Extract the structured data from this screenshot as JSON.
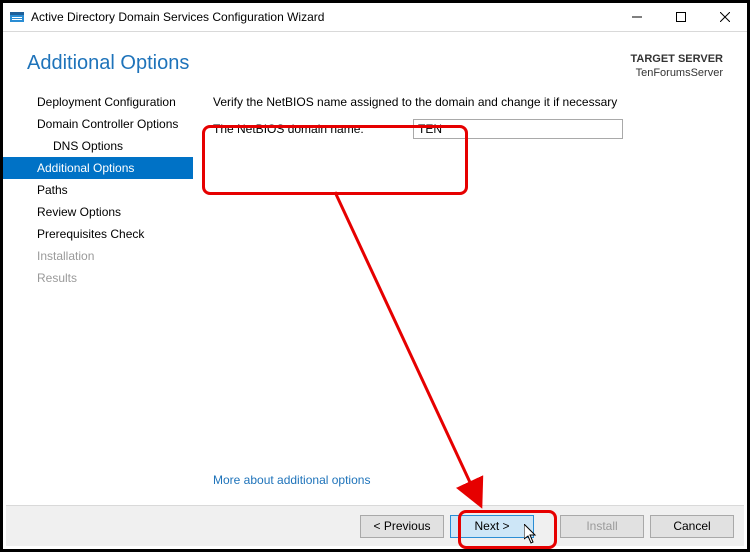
{
  "window": {
    "title": "Active Directory Domain Services Configuration Wizard"
  },
  "header": {
    "title": "Additional Options",
    "target_label": "TARGET SERVER",
    "target_value": "TenForumsServer"
  },
  "sidebar": {
    "items": [
      {
        "label": "Deployment Configuration",
        "selected": false,
        "disabled": false,
        "indent": false
      },
      {
        "label": "Domain Controller Options",
        "selected": false,
        "disabled": false,
        "indent": false
      },
      {
        "label": "DNS Options",
        "selected": false,
        "disabled": false,
        "indent": true
      },
      {
        "label": "Additional Options",
        "selected": true,
        "disabled": false,
        "indent": false
      },
      {
        "label": "Paths",
        "selected": false,
        "disabled": false,
        "indent": false
      },
      {
        "label": "Review Options",
        "selected": false,
        "disabled": false,
        "indent": false
      },
      {
        "label": "Prerequisites Check",
        "selected": false,
        "disabled": false,
        "indent": false
      },
      {
        "label": "Installation",
        "selected": false,
        "disabled": true,
        "indent": false
      },
      {
        "label": "Results",
        "selected": false,
        "disabled": true,
        "indent": false
      }
    ]
  },
  "content": {
    "instruction": "Verify the NetBIOS name assigned to the domain and change it if necessary",
    "field_label": "The NetBIOS domain name:",
    "field_value": "TEN",
    "more_link": "More about additional options"
  },
  "footer": {
    "previous": "< Previous",
    "next": "Next >",
    "install": "Install",
    "cancel": "Cancel"
  },
  "colors": {
    "accent": "#1e73ba",
    "selection": "#0072c6",
    "callout": "#e60000"
  }
}
